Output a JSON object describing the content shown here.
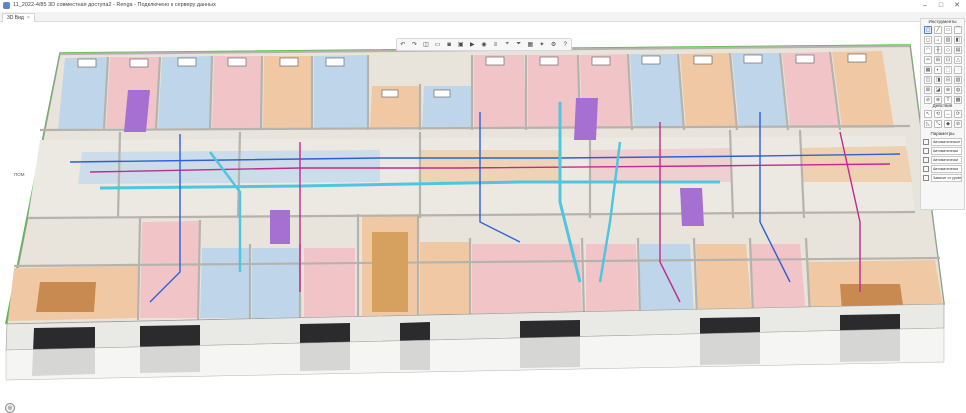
{
  "window": {
    "title": "11_2022-4/85 3D совместная доступа2 - Renga - Подключено к серверу данных",
    "minimize_glyph": "–",
    "maximize_glyph": "□",
    "close_glyph": "✕"
  },
  "tabs": [
    {
      "label": "3D Вид"
    }
  ],
  "toolbar": {
    "icons": [
      "undo-icon",
      "redo-icon",
      "view-cube-icon",
      "section-icon",
      "camera-icon",
      "save-view-icon",
      "display-mode-icon",
      "visibility-icon",
      "layers-icon",
      "measure-icon",
      "filter-icon",
      "grid-icon",
      "render-icon",
      "settings-icon",
      "help-icon"
    ]
  },
  "panel": {
    "tools_title": "Инструменты",
    "actions_title": "Действия",
    "params_title": "Параметры",
    "params": [
      "Автоматическое",
      "Автоматически",
      "Автоматически",
      "Автоматически",
      "Зависит от уровня"
    ]
  },
  "model_labels": {
    "ground_floor": "1",
    "room_tag": "ПОМ"
  },
  "colors": {
    "accent": "#4a7fd3",
    "pipe_blue": "#2f5fd8",
    "pipe_magenta": "#c02b8e",
    "pipe_cyan": "#4fc6de",
    "wall_gray": "#c9c9c7",
    "floor_peach": "#f0c9a4",
    "floor_pink": "#f1c5c8",
    "floor_blue": "#bfd6ea",
    "ceiling_green": "#58b948"
  }
}
